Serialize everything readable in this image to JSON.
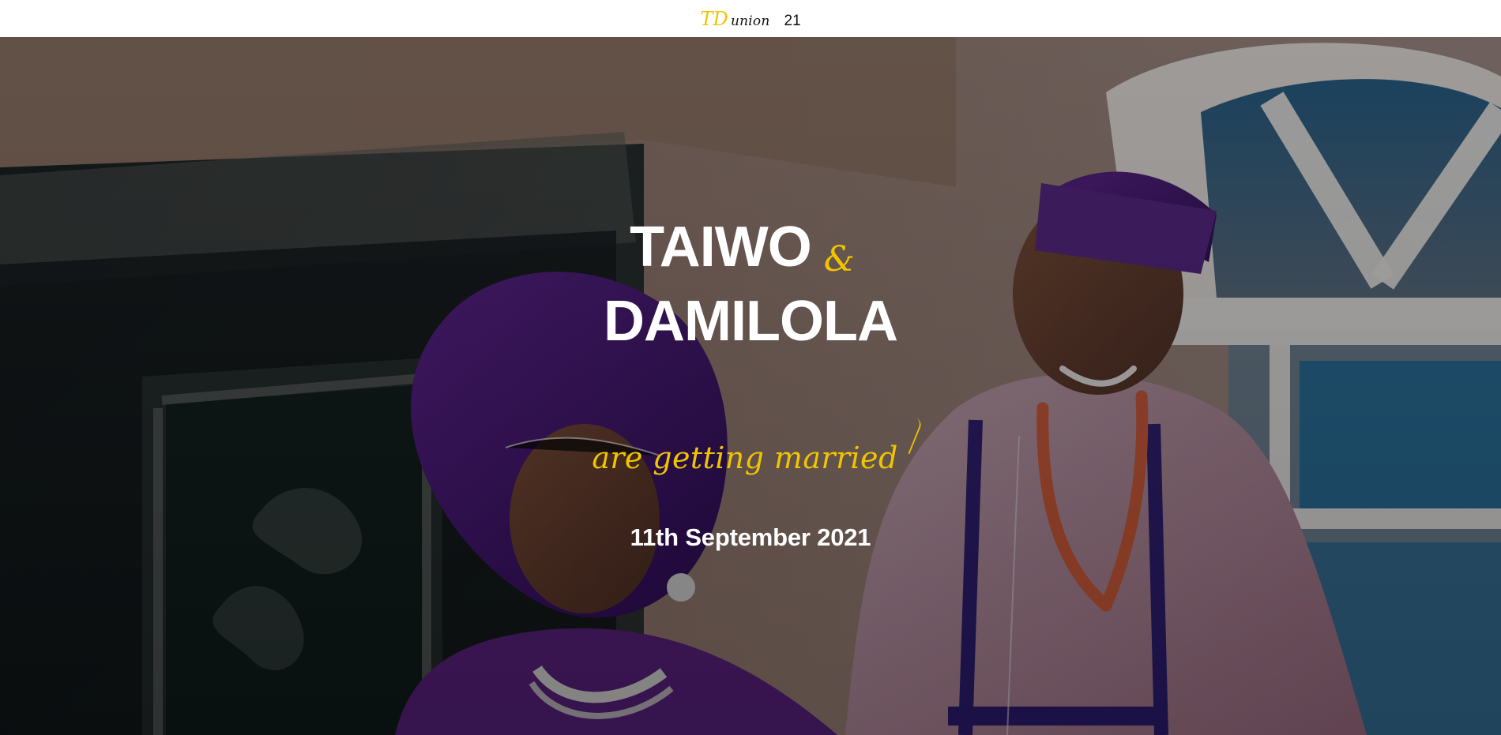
{
  "header": {
    "logo_initials": "TD",
    "logo_suffix": "union",
    "year_suffix": "21"
  },
  "hero": {
    "first_name": "TAIWO",
    "ampersand": "&",
    "second_name": "DAMILOLA",
    "tagline": "are getting married",
    "date": "11th September 2021"
  },
  "colors": {
    "accent_gold": "#f0c500",
    "white_text": "#ffffff",
    "dark_text": "#111111"
  }
}
